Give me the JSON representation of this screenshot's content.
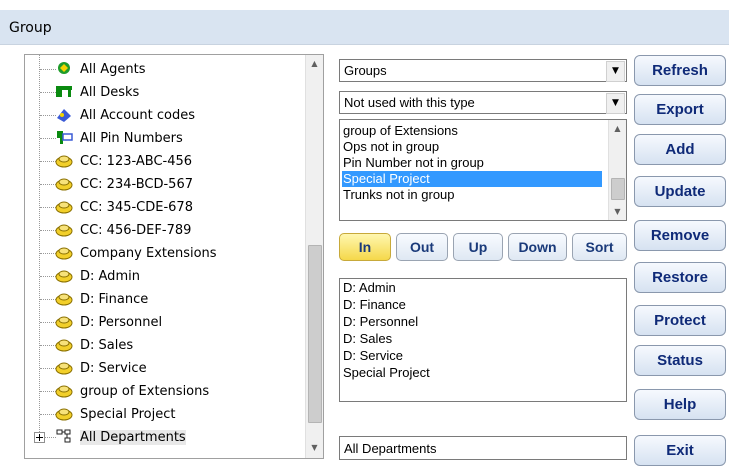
{
  "window": {
    "title": "Group"
  },
  "tree": {
    "items": [
      {
        "label": "All Agents",
        "icon": "agents-icon"
      },
      {
        "label": "All Desks",
        "icon": "desk-icon"
      },
      {
        "label": "All Account codes",
        "icon": "account-code-icon"
      },
      {
        "label": "All Pin Numbers",
        "icon": "pin-number-icon"
      },
      {
        "label": "CC: 123-ABC-456",
        "icon": "phone-group-icon"
      },
      {
        "label": "CC: 234-BCD-567",
        "icon": "phone-group-icon"
      },
      {
        "label": "CC: 345-CDE-678",
        "icon": "phone-group-icon"
      },
      {
        "label": "CC: 456-DEF-789",
        "icon": "phone-group-icon"
      },
      {
        "label": "Company Extensions",
        "icon": "phone-group-icon"
      },
      {
        "label": "D: Admin",
        "icon": "phone-group-icon"
      },
      {
        "label": "D: Finance",
        "icon": "phone-group-icon"
      },
      {
        "label": "D: Personnel",
        "icon": "phone-group-icon"
      },
      {
        "label": "D: Sales",
        "icon": "phone-group-icon"
      },
      {
        "label": "D: Service",
        "icon": "phone-group-icon"
      },
      {
        "label": "group of Extensions",
        "icon": "phone-group-icon"
      },
      {
        "label": "Special Project",
        "icon": "phone-group-icon"
      },
      {
        "label": "All Departments",
        "icon": "departments-icon"
      }
    ]
  },
  "group_type_combo": {
    "value": "Groups"
  },
  "filter_combo": {
    "value": "Not used with this type"
  },
  "type_list": {
    "items": [
      "group of Extensions",
      "Ops not in group",
      "Pin Number not in group",
      "Special Project",
      "Trunks not in group"
    ],
    "selected": "Special Project"
  },
  "action_buttons": {
    "in": "In",
    "out": "Out",
    "up": "Up",
    "down": "Down",
    "sort": "Sort"
  },
  "member_list": {
    "items": [
      "D: Admin",
      "D: Finance",
      "D: Personnel",
      "D: Sales",
      "D: Service",
      "Special Project"
    ]
  },
  "name_field": {
    "value": "All Departments"
  },
  "side_buttons": {
    "refresh": "Refresh",
    "export": "Export",
    "add": "Add",
    "update": "Update",
    "remove": "Remove",
    "restore": "Restore",
    "protect": "Protect",
    "status": "Status",
    "help": "Help",
    "exit": "Exit"
  },
  "colors": {
    "selection": "#3399ff",
    "titlebar": "#d9e4f1",
    "button_text": "#0f2a78",
    "active_button": "#f5d84a"
  }
}
